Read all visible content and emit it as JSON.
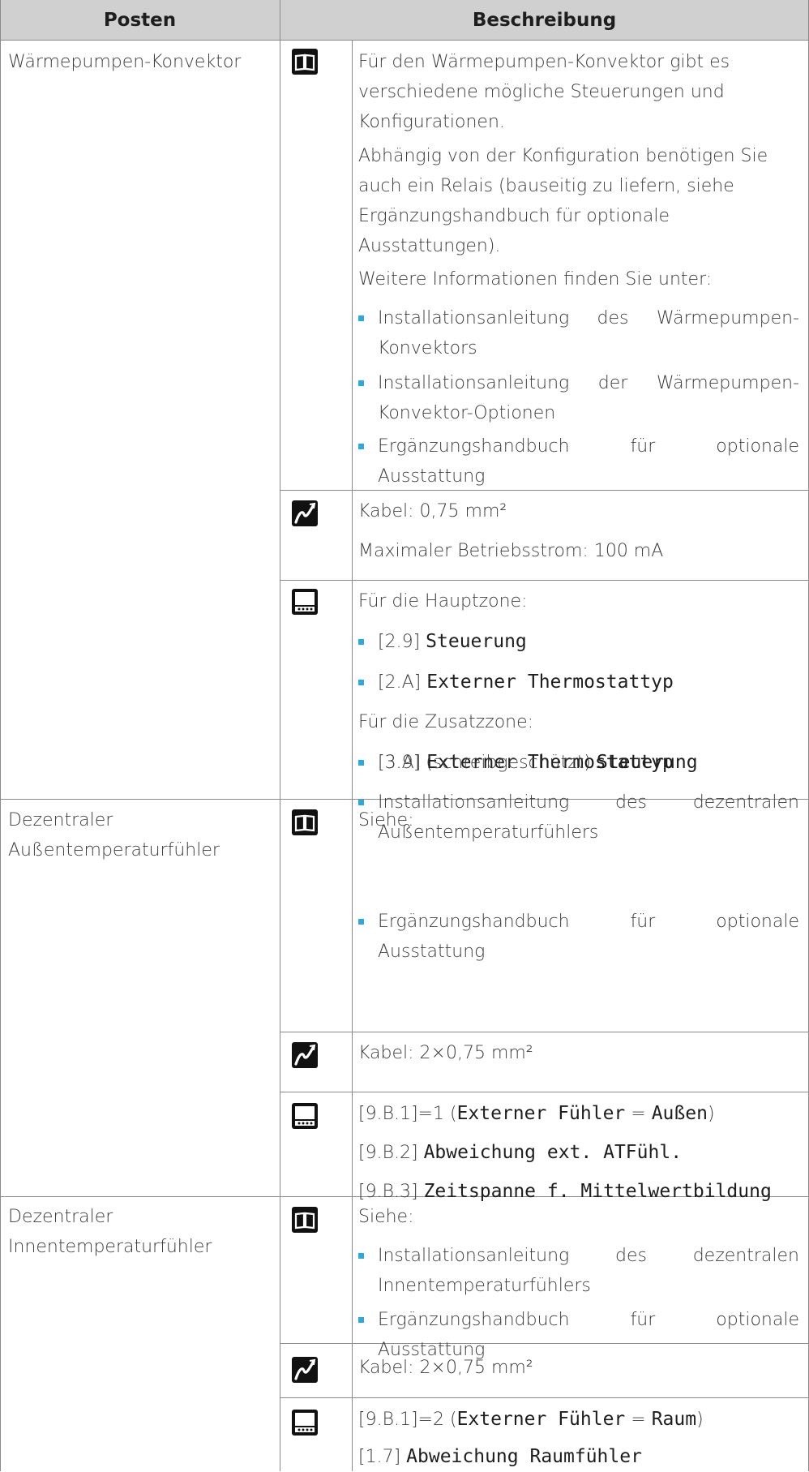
{
  "header": {
    "posten": "Posten",
    "beschreibung": "Beschreibung"
  },
  "rows": [
    {
      "posten": "Wärmepumpen-Konvektor",
      "book": {
        "p1": "Für den Wärmepumpen-Konvektor gibt es verschiedene mögliche Steuerungen und Konfigurationen.",
        "p2": "Abhängig von der Konfiguration benötigen Sie auch ein Relais (bauseitig zu liefern, siehe Ergänzungshandbuch für optionale Ausstattungen).",
        "p3": "Weitere Informationen finden Sie unter:",
        "b1": "Installationsanleitung des Wärmepumpen-Konvektors",
        "b2": "Installationsanleitung der Wärmepumpen-Konvektor-Optionen",
        "b3": "Ergänzungshandbuch für optionale Ausstattung"
      },
      "cable": {
        "l1": "Kabel: 0,75 mm²",
        "l2": "Maximaler Betriebsstrom: 100 mA"
      },
      "ui": {
        "l1": "Für die Hauptzone:",
        "b1_code": "[2.9]",
        "b1_name": "Steuerung",
        "b2_code": "[2.A]",
        "b2_name": "Externer Thermostattyp",
        "l2": "Für die Zusatzzone:",
        "b3_code": "[3.A]",
        "b3_name": "Externer Thermostattyp",
        "b4_code": "[3.9] (schreibgeschützt)",
        "b4_name": "Steuerung"
      }
    },
    {
      "posten": "Dezentraler Außentemperaturfühler",
      "book": {
        "p1": "Siehe:",
        "b1": "Installationsanleitung des dezentralen Außentemperaturfühlers",
        "b2": "Ergänzungshandbuch für optionale Ausstattung"
      },
      "cable": {
        "l1": "Kabel: 2×0,75 mm²"
      },
      "ui": {
        "l1_code": "[9.B.1]=1 (",
        "l1_name": "Externer Fühler",
        "l1_eq": " = ",
        "l1_val": "Außen",
        "l1_close": ")",
        "l2_code": "[9.B.2]",
        "l2_name": "Abweichung ext. ATFühl.",
        "l3_code": "[9.B.3]",
        "l3_name": "Zeitspanne f. Mittelwertbildung"
      }
    },
    {
      "posten": "Dezentraler Innentemperaturfühler",
      "book": {
        "p1": "Siehe:",
        "b1": "Installationsanleitung des dezentralen Innentemperaturfühlers",
        "b2": "Ergänzungshandbuch für optionale Ausstattung"
      },
      "cable": {
        "l1": "Kabel: 2×0,75 mm²"
      },
      "ui": {
        "l1_code": "[9.B.1]=2 (",
        "l1_name": "Externer Fühler",
        "l1_eq": " = ",
        "l1_val": "Raum",
        "l1_close": ")",
        "l2_code": "[1.7]",
        "l2_name": "Abweichung Raumfühler"
      }
    }
  ]
}
